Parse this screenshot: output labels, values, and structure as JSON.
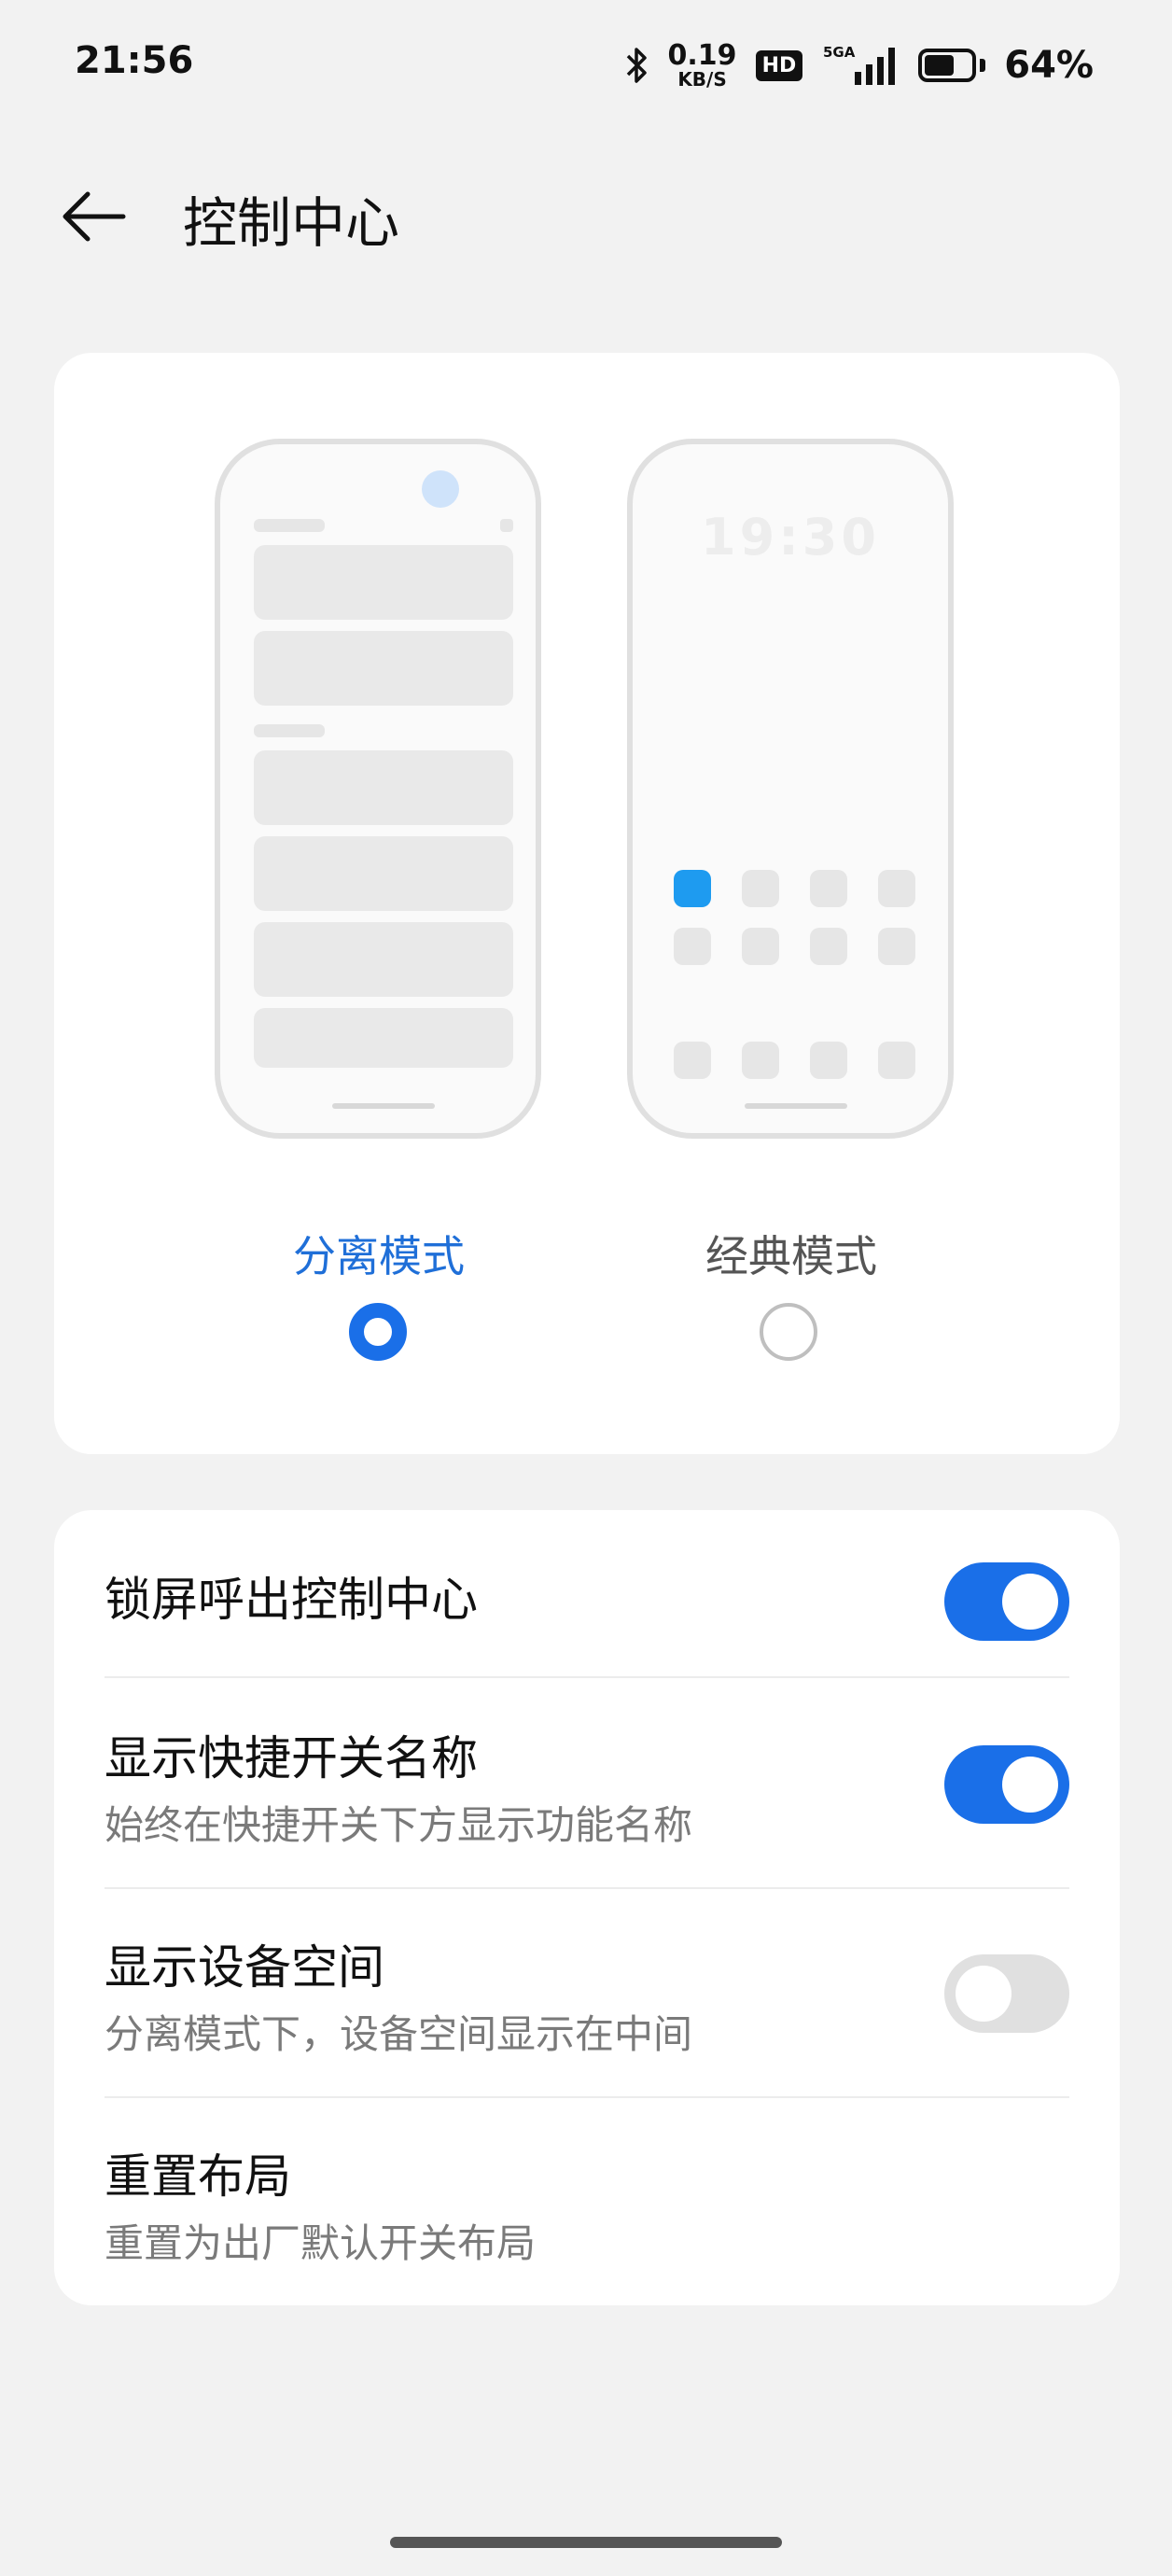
{
  "status_bar": {
    "time": "21:56",
    "net_speed_value": "0.19",
    "net_speed_unit": "KB/S",
    "hd_badge": "HD",
    "signal_label": "5GA",
    "battery_percent": "64%",
    "battery_level": 0.64
  },
  "header": {
    "title": "控制中心"
  },
  "mode_picker": {
    "illustration_clock": "19:30",
    "split": {
      "label": "分离模式",
      "selected": true
    },
    "classic": {
      "label": "经典模式",
      "selected": false
    }
  },
  "settings": [
    {
      "title": "锁屏呼出控制中心",
      "subtitle": "",
      "toggle": true
    },
    {
      "title": "显示快捷开关名称",
      "subtitle": "始终在快捷开关下方显示功能名称",
      "toggle": true
    },
    {
      "title": "显示设备空间",
      "subtitle": "分离模式下，设备空间显示在中间",
      "toggle": false
    },
    {
      "title": "重置布局",
      "subtitle": "重置为出厂默认开关布局",
      "toggle": null
    }
  ],
  "colors": {
    "accent": "#1a6fe8",
    "background": "#f2f2f2",
    "card": "#ffffff"
  }
}
